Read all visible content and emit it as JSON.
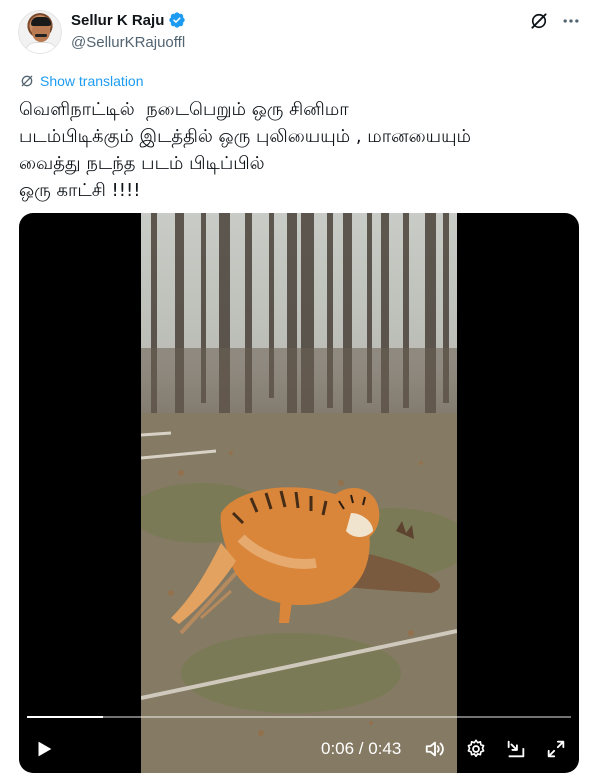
{
  "author": {
    "display_name": "Sellur K Raju",
    "handle": "@SellurKRajuoffl",
    "verified": true
  },
  "header_actions": {
    "grok_icon": "grok-icon",
    "more_icon": "more-horizontal-icon"
  },
  "translation": {
    "label": "Show translation",
    "icon": "translate-icon"
  },
  "tweet": {
    "text_lines": [
      "வெளிநாட்டில்  நடைபெறும் ஒரு சினிமா",
      "படம்பிடிக்கும் இடத்தில் ஒரு புலியையும் , மானயையும்",
      "வைத்து நடந்த படம் பிடிப்பில்",
      "ஒரு காட்சி !!!!"
    ]
  },
  "video": {
    "current_time": "0:06",
    "duration": "0:43",
    "time_display": "0:06 / 0:43",
    "progress_fraction": 0.14,
    "controls": [
      "play-icon",
      "volume-icon",
      "settings-icon",
      "picture-in-picture-icon",
      "fullscreen-icon"
    ]
  },
  "colors": {
    "accent": "#1d9bf0",
    "text_primary": "#0f1419",
    "text_secondary": "#536471",
    "media_background": "#000000"
  }
}
